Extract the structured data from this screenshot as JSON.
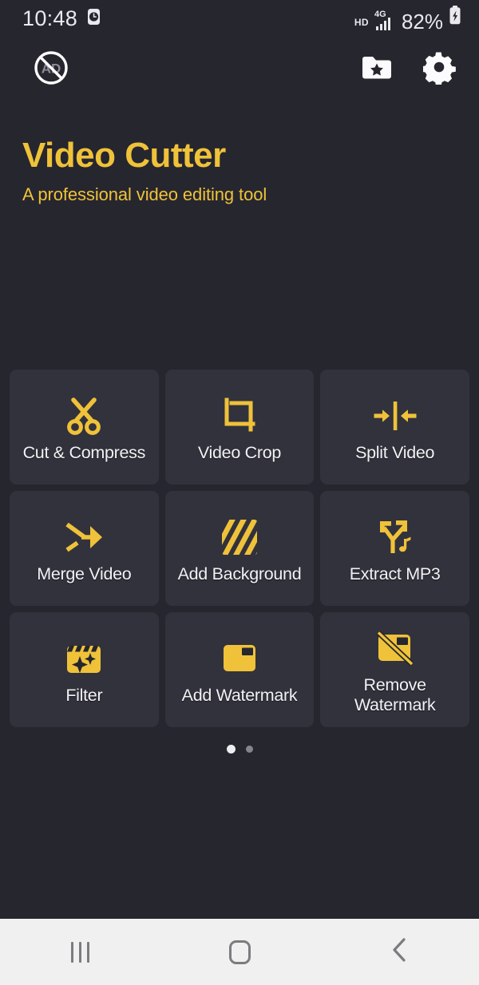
{
  "status_bar": {
    "time": "10:48",
    "alarm_icon": "alarm-clock-icon",
    "network_hd": "HD",
    "network_type": "4G",
    "battery_percent": "82%",
    "battery_icon": "battery-charging-icon"
  },
  "toolbar": {
    "no_ads": {
      "label": "AD",
      "name": "no-ads-icon"
    },
    "my_files": {
      "name": "folder-star-icon"
    },
    "settings": {
      "name": "gear-icon"
    }
  },
  "header": {
    "title": "Video Cutter",
    "subtitle": "A professional video editing tool"
  },
  "colors": {
    "background": "#26262f",
    "tile_background": "#32323d",
    "accent": "#efc239",
    "text_primary": "#f2f2f5",
    "navbar_background": "#f0f0f0",
    "navbar_icon": "#7b7b80"
  },
  "tools": [
    {
      "label": "Cut & Compress",
      "icon": "scissors-icon"
    },
    {
      "label": "Video Crop",
      "icon": "crop-icon"
    },
    {
      "label": "Split Video",
      "icon": "split-arrows-icon"
    },
    {
      "label": "Merge Video",
      "icon": "merge-arrow-icon"
    },
    {
      "label": "Add Background",
      "icon": "diagonal-stripes-icon"
    },
    {
      "label": "Extract MP3",
      "icon": "fork-arrows-music-note-icon"
    },
    {
      "label": "Filter",
      "icon": "clapperboard-sparkle-icon"
    },
    {
      "label": "Add Watermark",
      "icon": "watermark-square-icon"
    },
    {
      "label": "Remove Watermark",
      "icon": "watermark-square-slash-icon"
    }
  ],
  "pager": {
    "total": 2,
    "current": 1
  },
  "nav_bar": {
    "recents": "recents-icon",
    "home": "home-icon",
    "back": "back-icon"
  }
}
